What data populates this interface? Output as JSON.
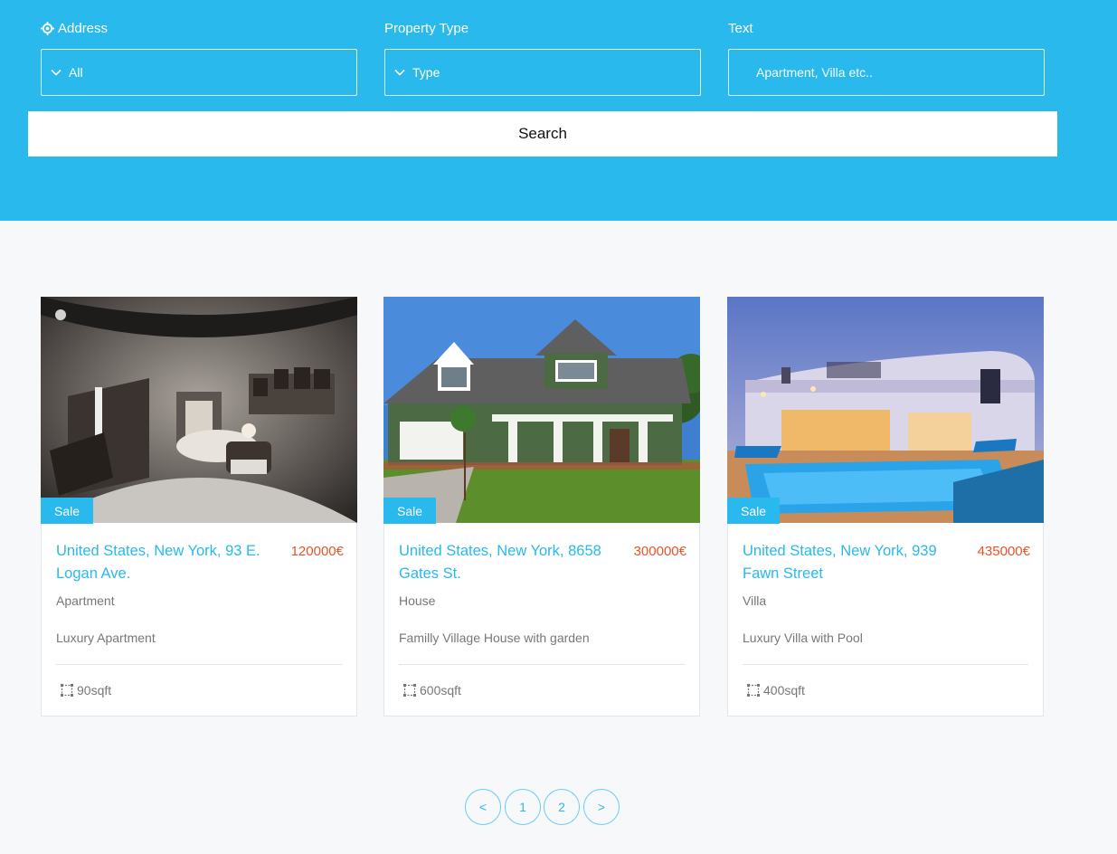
{
  "search": {
    "address": {
      "label": "Address",
      "value": "All"
    },
    "property_type": {
      "label": "Property Type",
      "value": "Type"
    },
    "text": {
      "label": "Text",
      "placeholder": "Apartment, Villa etc.."
    },
    "button_label": "Search"
  },
  "listings": [
    {
      "badge": "Sale",
      "title": "United States, New York, 93 E. Logan Ave.",
      "price": "120000€",
      "type": "Apartment",
      "description": "Luxury Apartment",
      "area": "90sqft",
      "image": "bedroom-panorama"
    },
    {
      "badge": "Sale",
      "title": "United States, New York, 8658 Gates St.",
      "price": "300000€",
      "type": "House",
      "description": "Familly Village House with garden",
      "area": "600sqft",
      "image": "suburban-house"
    },
    {
      "badge": "Sale",
      "title": "United States, New York, 939 Fawn Street",
      "price": "435000€",
      "type": "Villa",
      "description": "Luxury Villa with Pool",
      "area": "400sqft",
      "image": "villa-with-pool"
    }
  ],
  "pagination": {
    "prev": "<",
    "pages": [
      "1",
      "2"
    ],
    "next": ">"
  },
  "colors": {
    "accent": "#29b9ec",
    "price": "#e8542a",
    "background": "#f7f8fa",
    "text": "#777777"
  },
  "icons": {
    "address": "location-target-icon",
    "dropdown": "chevron-down-icon",
    "area": "area-icon"
  }
}
